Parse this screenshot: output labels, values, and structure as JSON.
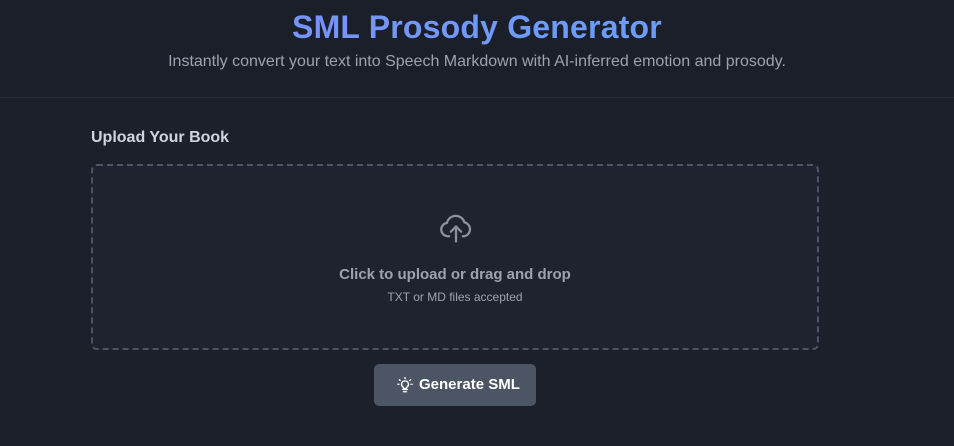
{
  "header": {
    "title": "SML Prosody Generator",
    "subtitle": "Instantly convert your text into Speech Markdown with AI-inferred emotion and prosody."
  },
  "upload": {
    "section_label": "Upload Your Book",
    "icon": "upload-cloud-icon",
    "primary_text": "Click to upload or drag and drop",
    "secondary_text": "TXT or MD files accepted"
  },
  "actions": {
    "generate_label": "Generate SML",
    "generate_icon": "lightbulb-icon"
  },
  "colors": {
    "background": "#1b1f2a",
    "title_gradient_start": "#818cf8",
    "title_gradient_end": "#60a5fa",
    "button_bg": "#4b5563",
    "muted_text": "#9ca3af"
  }
}
